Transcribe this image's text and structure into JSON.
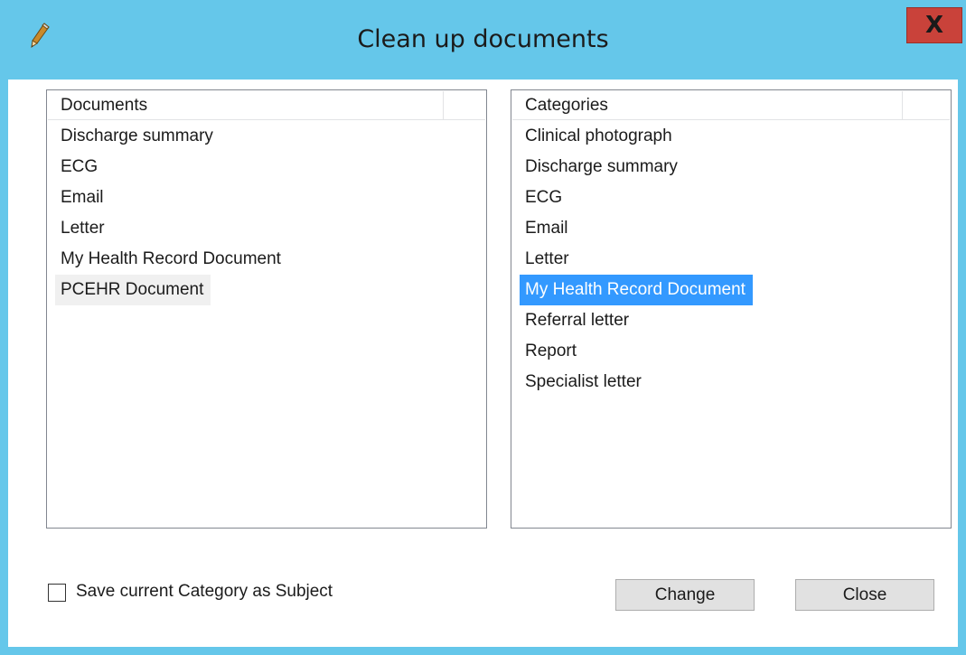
{
  "window": {
    "title": "Clean up documents",
    "close_glyph": "X",
    "icon": "pencil-icon"
  },
  "documents_list": {
    "header": "Documents",
    "items": [
      "Discharge summary",
      "ECG",
      "Email",
      "Letter",
      "My Health Record Document",
      "PCEHR Document"
    ],
    "selected_item": "PCEHR Document"
  },
  "categories_list": {
    "header": "Categories",
    "items": [
      "Clinical photograph",
      "Discharge summary",
      "ECG",
      "Email",
      "Letter",
      "My Health Record Document",
      "Referral letter",
      "Report",
      "Specialist letter"
    ],
    "selected_item": "My Health Record Document"
  },
  "options": {
    "save_category_label": "Save current Category as Subject",
    "save_category_checked": false
  },
  "buttons": {
    "change_label": "Change",
    "close_label": "Close"
  },
  "colors": {
    "titlebar": "#65c7ea",
    "close_button": "#c9423a",
    "selection_active": "#3399ff",
    "selection_inactive": "#f0f0f0"
  }
}
